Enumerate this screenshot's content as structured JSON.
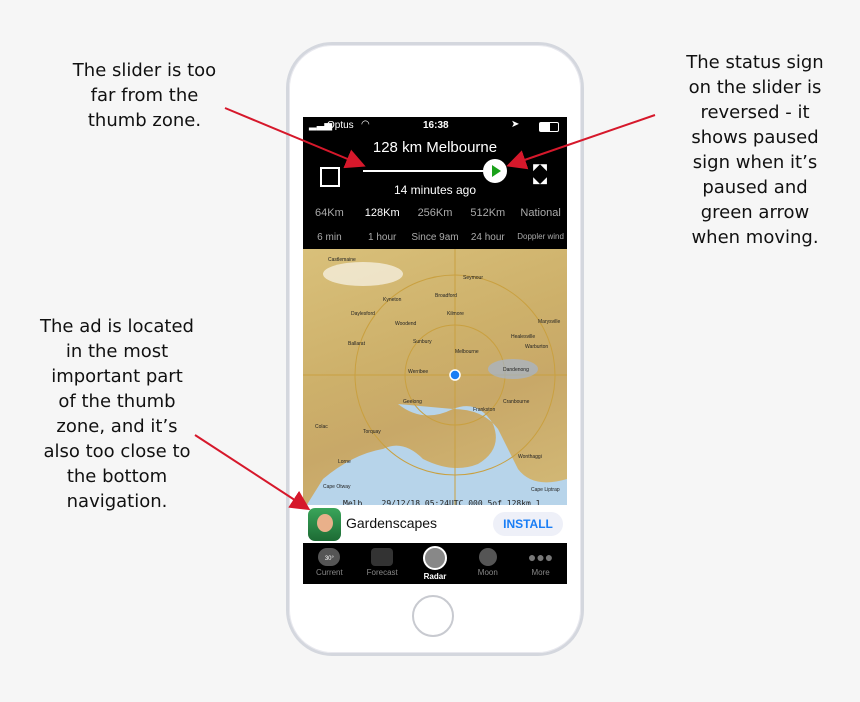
{
  "annotations": {
    "slider": "The slider is too\nfar from the\nthumb zone.",
    "status": "The status sign\non the slider is\nreversed - it\nshows paused\nsign when it’s\npaused and\ngreen arrow\nwhen moving.",
    "ad": "The ad is located\nin the most\nimportant part\nof the thumb\nzone, and it’s\nalso too close to\nthe bottom\nnavigation."
  },
  "colors": {
    "arrow": "#d6182b",
    "play": "#1aa11a",
    "install": "#1a7ef5"
  },
  "status_bar": {
    "carrier": "Optus",
    "time": "16:38"
  },
  "radar": {
    "title": "128 km Melbourne",
    "ago": "14 minutes ago",
    "ranges": [
      "64Km",
      "128Km",
      "256Km",
      "512Km",
      "National"
    ],
    "times": [
      "6 min",
      "1 hour",
      "Since 9am",
      "24 hour",
      "Doppler wind"
    ],
    "selected_range": "128Km",
    "slider_position": 1.0,
    "play_state": "play-icon",
    "map_footer": "Melb    29/12/18 05:24UTC 000 5of 128km 1",
    "places": [
      "Castlemaine",
      "Kyneton",
      "Broadford",
      "Seymour",
      "Daylesford",
      "Woodend",
      "Kilmore",
      "Ballarat",
      "Sunbury",
      "Melbourne",
      "Geelong",
      "Werribee",
      "Frankston",
      "Dandenong",
      "Cranbourne",
      "Torquay",
      "Cape Otway",
      "Lorne",
      "Wonthaggi",
      "Cape Liptrap",
      "Colac",
      "Warburton",
      "Marysville",
      "Healesville"
    ]
  },
  "ad": {
    "name": "Gardenscapes",
    "button": "INSTALL"
  },
  "tabs": [
    {
      "label": "Current",
      "icon": "cloud-temperature-icon",
      "badge": "30°"
    },
    {
      "label": "Forecast",
      "icon": "chart-line-icon"
    },
    {
      "label": "Radar",
      "icon": "radar-icon",
      "active": true
    },
    {
      "label": "Moon",
      "icon": "moon-icon"
    },
    {
      "label": "More",
      "icon": "more-dots-icon"
    }
  ]
}
